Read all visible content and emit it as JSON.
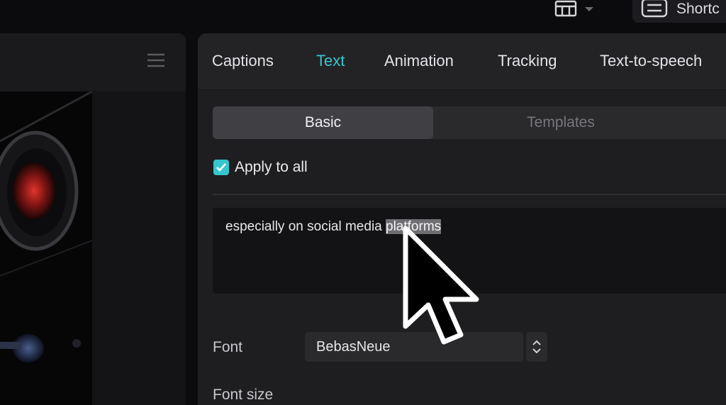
{
  "topbar": {
    "layout_icon": "layout-grid-icon",
    "dropdown_icon": "chevron-down-icon",
    "shortcut_icon": "keyboard-icon",
    "shortcut_label": "Shortc"
  },
  "player": {
    "menu_icon": "hamburger-menu-icon"
  },
  "tabs": [
    {
      "label": "Captions",
      "active": false
    },
    {
      "label": "Text",
      "active": true
    },
    {
      "label": "Animation",
      "active": false
    },
    {
      "label": "Tracking",
      "active": false
    },
    {
      "label": "Text-to-speech",
      "active": false
    }
  ],
  "segment": {
    "basic": "Basic",
    "templates": "Templates",
    "selected": "Basic"
  },
  "apply_all": {
    "label": "Apply to all",
    "checked": true
  },
  "caption_text": {
    "before": "especially on social media ",
    "selected": "platforms"
  },
  "font": {
    "label": "Font",
    "value": "BebasNeue"
  },
  "font_size": {
    "label": "Font size"
  },
  "colors": {
    "accent": "#35c6cf",
    "panel": "#1e1e21",
    "background": "#0b0b0d"
  }
}
